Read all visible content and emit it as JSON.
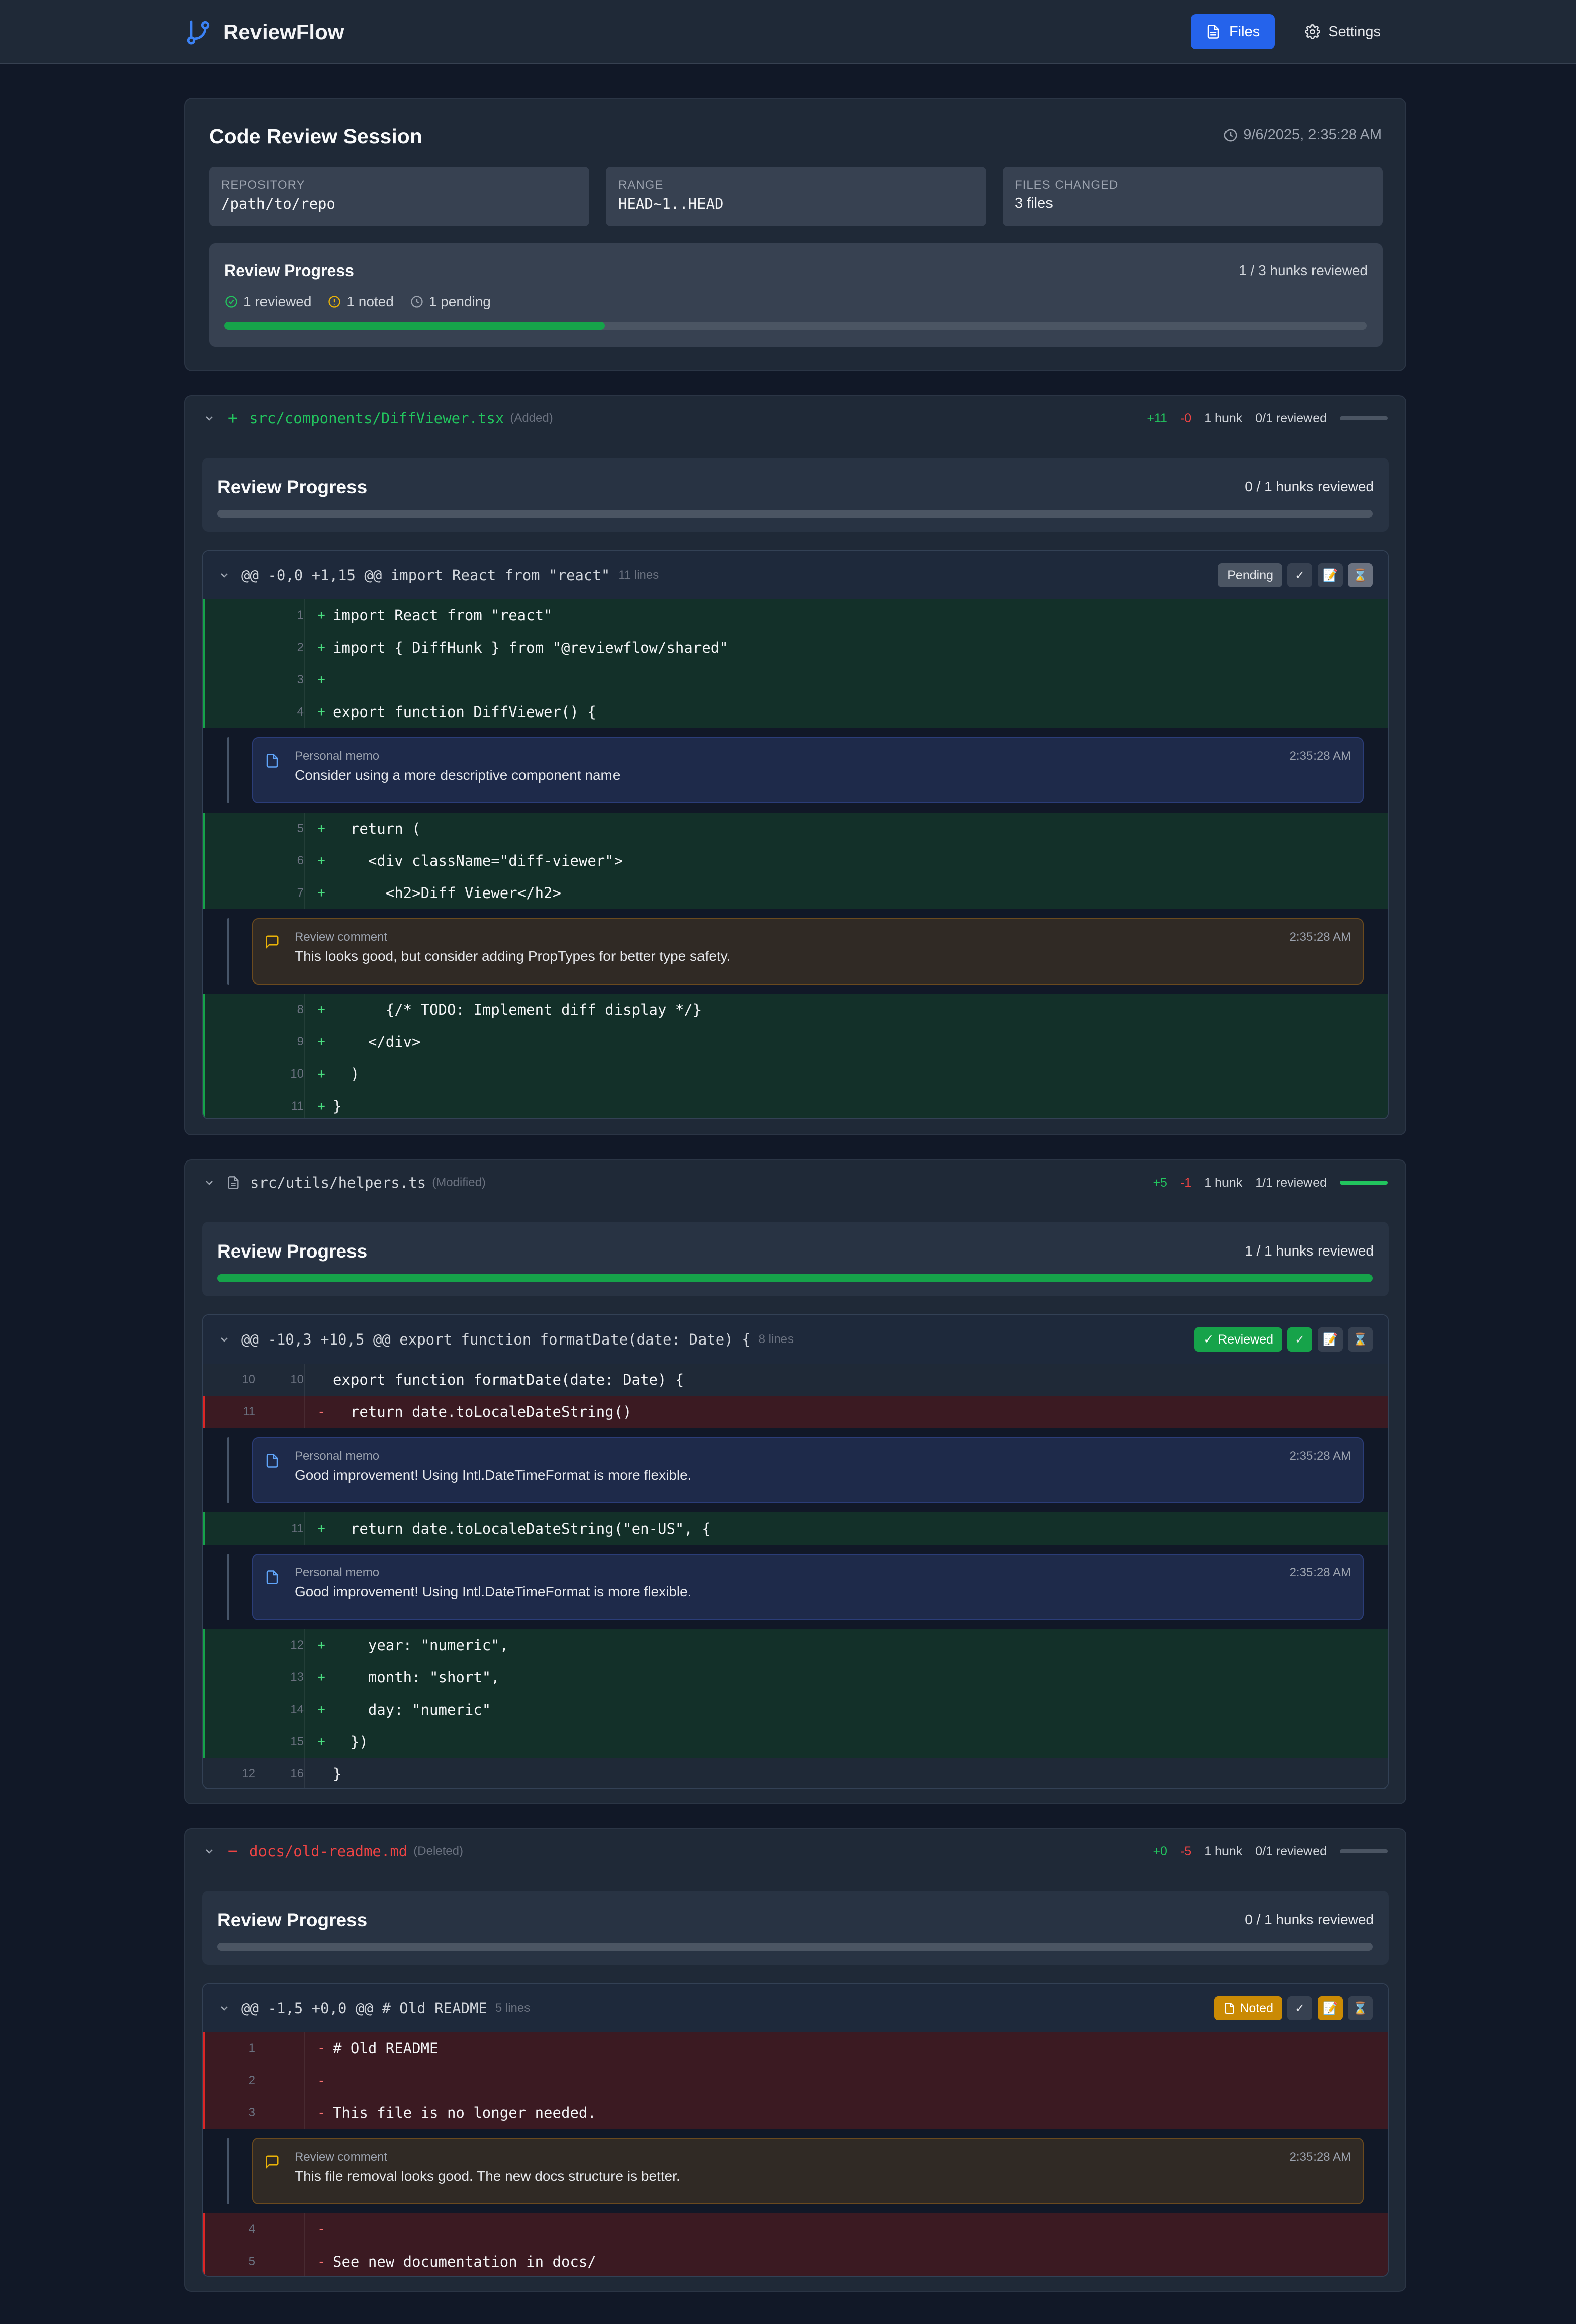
{
  "app": {
    "name": "ReviewFlow",
    "nav": {
      "files": "Files",
      "settings": "Settings"
    }
  },
  "session": {
    "title": "Code Review Session",
    "timestamp": "9/6/2025, 2:35:28 AM",
    "repository": {
      "label": "REPOSITORY",
      "value": "/path/to/repo"
    },
    "range": {
      "label": "RANGE",
      "value": "HEAD~1..HEAD"
    },
    "files_changed": {
      "label": "FILES CHANGED",
      "value": "3 files"
    },
    "progress": {
      "title": "Review Progress",
      "count": "1 / 3 hunks reviewed",
      "reviewed": "1 reviewed",
      "noted": "1 noted",
      "pending": "1 pending",
      "fraction": 0.333
    }
  },
  "files": [
    {
      "path": "src/components/DiffViewer.tsx",
      "status": "(Added)",
      "additions": "+11",
      "deletions": "-0",
      "hunks": "1 hunk",
      "reviewed": "0/1 reviewed",
      "reviewed_fraction": 0,
      "progress_title": "Review Progress",
      "progress_count": "0 / 1 hunks reviewed",
      "hunk": {
        "header": "@@ -0,0 +1,15 @@ import React from \"react\"",
        "lines": "11 lines",
        "badge": "Pending",
        "rows": [
          {
            "n": "1",
            "s": "+",
            "c": "import React from \"react\""
          },
          {
            "n": "2",
            "s": "+",
            "c": "import { DiffHunk } from \"@reviewflow/shared\""
          },
          {
            "n": "3",
            "s": "+",
            "c": ""
          },
          {
            "n": "4",
            "s": "+",
            "c": "export function DiffViewer() {"
          },
          {
            "n": "5",
            "s": "+",
            "c": "  return ("
          },
          {
            "n": "6",
            "s": "+",
            "c": "    <div className=\"diff-viewer\">"
          },
          {
            "n": "7",
            "s": "+",
            "c": "      <h2>Diff Viewer</h2>"
          },
          {
            "n": "8",
            "s": "+",
            "c": "      {/* TODO: Implement diff display */}"
          },
          {
            "n": "9",
            "s": "+",
            "c": "    </div>"
          },
          {
            "n": "10",
            "s": "+",
            "c": "  )"
          },
          {
            "n": "11",
            "s": "+",
            "c": "}"
          }
        ],
        "comments": [
          {
            "type": "Personal memo",
            "time": "2:35:28 AM",
            "text": "Consider using a more descriptive component name"
          },
          {
            "type": "Review comment",
            "time": "2:35:28 AM",
            "text": "This looks good, but consider adding PropTypes for better type safety."
          }
        ]
      }
    },
    {
      "path": "src/utils/helpers.ts",
      "status": "(Modified)",
      "additions": "+5",
      "deletions": "-1",
      "hunks": "1 hunk",
      "reviewed": "1/1 reviewed",
      "reviewed_fraction": 1,
      "progress_title": "Review Progress",
      "progress_count": "1 / 1 hunks reviewed",
      "hunk": {
        "header": "@@ -10,3 +10,5 @@ export function formatDate(date: Date) {",
        "lines": "8 lines",
        "badge": "Reviewed",
        "rows": [
          {
            "o": "10",
            "n": "10",
            "s": "",
            "c": "export function formatDate(date: Date) {"
          },
          {
            "o": "11",
            "n": "",
            "s": "-",
            "c": "  return date.toLocaleDateString()"
          },
          {
            "o": "",
            "n": "11",
            "s": "+",
            "c": "  return date.toLocaleDateString(\"en-US\", {"
          },
          {
            "o": "",
            "n": "12",
            "s": "+",
            "c": "    year: \"numeric\","
          },
          {
            "o": "",
            "n": "13",
            "s": "+",
            "c": "    month: \"short\","
          },
          {
            "o": "",
            "n": "14",
            "s": "+",
            "c": "    day: \"numeric\""
          },
          {
            "o": "",
            "n": "15",
            "s": "+",
            "c": "  })"
          },
          {
            "o": "12",
            "n": "16",
            "s": "",
            "c": "}"
          }
        ],
        "comments": [
          {
            "type": "Personal memo",
            "time": "2:35:28 AM",
            "text": "Good improvement! Using Intl.DateTimeFormat is more flexible."
          },
          {
            "type": "Personal memo",
            "time": "2:35:28 AM",
            "text": "Good improvement! Using Intl.DateTimeFormat is more flexible."
          }
        ]
      }
    },
    {
      "path": "docs/old-readme.md",
      "status": "(Deleted)",
      "additions": "+0",
      "deletions": "-5",
      "hunks": "1 hunk",
      "reviewed": "0/1 reviewed",
      "reviewed_fraction": 0,
      "progress_title": "Review Progress",
      "progress_count": "0 / 1 hunks reviewed",
      "hunk": {
        "header": "@@ -1,5 +0,0 @@ # Old README",
        "lines": "5 lines",
        "badge": "Noted",
        "rows": [
          {
            "o": "1",
            "s": "-",
            "c": "# Old README"
          },
          {
            "o": "2",
            "s": "-",
            "c": ""
          },
          {
            "o": "3",
            "s": "-",
            "c": "This file is no longer needed."
          },
          {
            "o": "4",
            "s": "-",
            "c": ""
          },
          {
            "o": "5",
            "s": "-",
            "c": "See new documentation in docs/"
          }
        ],
        "comments": [
          {
            "type": "Review comment",
            "time": "2:35:28 AM",
            "text": "This file removal looks good. The new docs structure is better."
          }
        ]
      }
    }
  ]
}
